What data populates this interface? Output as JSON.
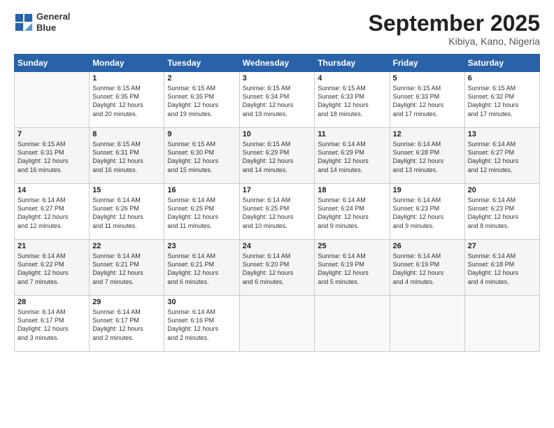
{
  "header": {
    "logo_line1": "General",
    "logo_line2": "Blue",
    "month": "September 2025",
    "location": "Kibiya, Kano, Nigeria"
  },
  "weekdays": [
    "Sunday",
    "Monday",
    "Tuesday",
    "Wednesday",
    "Thursday",
    "Friday",
    "Saturday"
  ],
  "weeks": [
    [
      {
        "day": "",
        "info": ""
      },
      {
        "day": "1",
        "info": "Sunrise: 6:15 AM\nSunset: 6:35 PM\nDaylight: 12 hours\nand 20 minutes."
      },
      {
        "day": "2",
        "info": "Sunrise: 6:15 AM\nSunset: 6:35 PM\nDaylight: 12 hours\nand 19 minutes."
      },
      {
        "day": "3",
        "info": "Sunrise: 6:15 AM\nSunset: 6:34 PM\nDaylight: 12 hours\nand 19 minutes."
      },
      {
        "day": "4",
        "info": "Sunrise: 6:15 AM\nSunset: 6:33 PM\nDaylight: 12 hours\nand 18 minutes."
      },
      {
        "day": "5",
        "info": "Sunrise: 6:15 AM\nSunset: 6:33 PM\nDaylight: 12 hours\nand 17 minutes."
      },
      {
        "day": "6",
        "info": "Sunrise: 6:15 AM\nSunset: 6:32 PM\nDaylight: 12 hours\nand 17 minutes."
      }
    ],
    [
      {
        "day": "7",
        "info": "Sunrise: 6:15 AM\nSunset: 6:31 PM\nDaylight: 12 hours\nand 16 minutes."
      },
      {
        "day": "8",
        "info": "Sunrise: 6:15 AM\nSunset: 6:31 PM\nDaylight: 12 hours\nand 16 minutes."
      },
      {
        "day": "9",
        "info": "Sunrise: 6:15 AM\nSunset: 6:30 PM\nDaylight: 12 hours\nand 15 minutes."
      },
      {
        "day": "10",
        "info": "Sunrise: 6:15 AM\nSunset: 6:29 PM\nDaylight: 12 hours\nand 14 minutes."
      },
      {
        "day": "11",
        "info": "Sunrise: 6:14 AM\nSunset: 6:29 PM\nDaylight: 12 hours\nand 14 minutes."
      },
      {
        "day": "12",
        "info": "Sunrise: 6:14 AM\nSunset: 6:28 PM\nDaylight: 12 hours\nand 13 minutes."
      },
      {
        "day": "13",
        "info": "Sunrise: 6:14 AM\nSunset: 6:27 PM\nDaylight: 12 hours\nand 12 minutes."
      }
    ],
    [
      {
        "day": "14",
        "info": "Sunrise: 6:14 AM\nSunset: 6:27 PM\nDaylight: 12 hours\nand 12 minutes."
      },
      {
        "day": "15",
        "info": "Sunrise: 6:14 AM\nSunset: 6:26 PM\nDaylight: 12 hours\nand 11 minutes."
      },
      {
        "day": "16",
        "info": "Sunrise: 6:14 AM\nSunset: 6:25 PM\nDaylight: 12 hours\nand 11 minutes."
      },
      {
        "day": "17",
        "info": "Sunrise: 6:14 AM\nSunset: 6:25 PM\nDaylight: 12 hours\nand 10 minutes."
      },
      {
        "day": "18",
        "info": "Sunrise: 6:14 AM\nSunset: 6:24 PM\nDaylight: 12 hours\nand 9 minutes."
      },
      {
        "day": "19",
        "info": "Sunrise: 6:14 AM\nSunset: 6:23 PM\nDaylight: 12 hours\nand 9 minutes."
      },
      {
        "day": "20",
        "info": "Sunrise: 6:14 AM\nSunset: 6:23 PM\nDaylight: 12 hours\nand 8 minutes."
      }
    ],
    [
      {
        "day": "21",
        "info": "Sunrise: 6:14 AM\nSunset: 6:22 PM\nDaylight: 12 hours\nand 7 minutes."
      },
      {
        "day": "22",
        "info": "Sunrise: 6:14 AM\nSunset: 6:21 PM\nDaylight: 12 hours\nand 7 minutes."
      },
      {
        "day": "23",
        "info": "Sunrise: 6:14 AM\nSunset: 6:21 PM\nDaylight: 12 hours\nand 6 minutes."
      },
      {
        "day": "24",
        "info": "Sunrise: 6:14 AM\nSunset: 6:20 PM\nDaylight: 12 hours\nand 6 minutes."
      },
      {
        "day": "25",
        "info": "Sunrise: 6:14 AM\nSunset: 6:19 PM\nDaylight: 12 hours\nand 5 minutes."
      },
      {
        "day": "26",
        "info": "Sunrise: 6:14 AM\nSunset: 6:19 PM\nDaylight: 12 hours\nand 4 minutes."
      },
      {
        "day": "27",
        "info": "Sunrise: 6:14 AM\nSunset: 6:18 PM\nDaylight: 12 hours\nand 4 minutes."
      }
    ],
    [
      {
        "day": "28",
        "info": "Sunrise: 6:14 AM\nSunset: 6:17 PM\nDaylight: 12 hours\nand 3 minutes."
      },
      {
        "day": "29",
        "info": "Sunrise: 6:14 AM\nSunset: 6:17 PM\nDaylight: 12 hours\nand 2 minutes."
      },
      {
        "day": "30",
        "info": "Sunrise: 6:14 AM\nSunset: 6:16 PM\nDaylight: 12 hours\nand 2 minutes."
      },
      {
        "day": "",
        "info": ""
      },
      {
        "day": "",
        "info": ""
      },
      {
        "day": "",
        "info": ""
      },
      {
        "day": "",
        "info": ""
      }
    ]
  ]
}
